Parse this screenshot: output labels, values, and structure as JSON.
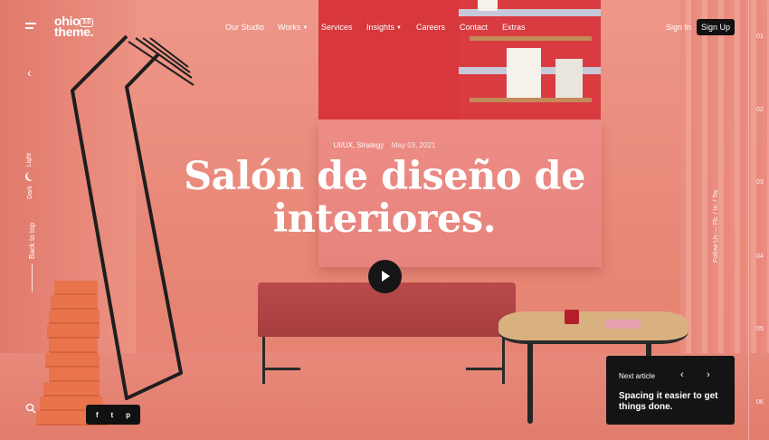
{
  "header": {
    "logo_text": "ohio",
    "logo_text_2": "theme.",
    "logo_version": "3.0",
    "nav": [
      {
        "label": "Our Studio",
        "has_caret": false
      },
      {
        "label": "Works",
        "has_caret": true
      },
      {
        "label": "Services",
        "has_caret": false
      },
      {
        "label": "Insights",
        "has_caret": true
      },
      {
        "label": "Careers",
        "has_caret": false
      },
      {
        "label": "Contact",
        "has_caret": false
      },
      {
        "label": "Extras",
        "has_caret": false
      }
    ],
    "sign_in": "Sign In",
    "sign_up": "Sign Up"
  },
  "sidebar_left": {
    "theme_light": "Light",
    "theme_dark": "Dark",
    "back_to_top": "Back to top",
    "social": [
      "f",
      "t",
      "p"
    ]
  },
  "hero": {
    "category": "UI/UX, Strategy",
    "separator": "·",
    "date": "May 03, 2021",
    "title_line_1": "Salón de diseño de",
    "title_line_2": "interiores."
  },
  "follow": {
    "label": "Follow Us —",
    "links": [
      "Fb.",
      "In.",
      "Tw."
    ],
    "separator": "/"
  },
  "rail_numbers": [
    "01",
    "02",
    "03",
    "04",
    "05",
    "06"
  ],
  "next_article": {
    "label": "Next article",
    "prev_icon": "‹",
    "next_icon": "›",
    "title": "Spacing it easier to get things done."
  },
  "colors": {
    "background": "#e98a7c",
    "accent_red": "#e0372d",
    "dark": "#141414"
  }
}
